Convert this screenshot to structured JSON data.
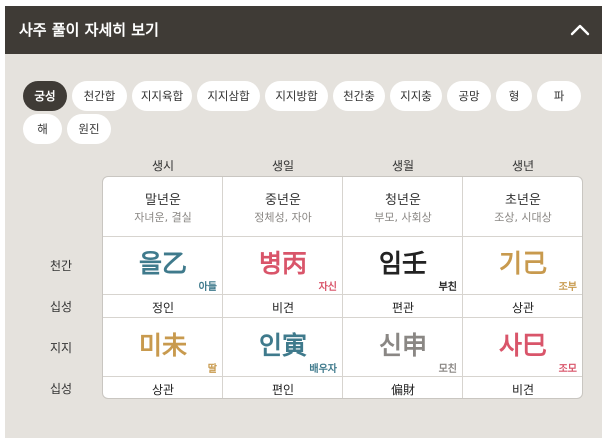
{
  "header": {
    "title": "사주 풀이 자세히 보기",
    "toggle_icon": "chevron-up-icon"
  },
  "tabs": [
    {
      "label": "궁성",
      "active": true
    },
    {
      "label": "천간합"
    },
    {
      "label": "지지육합"
    },
    {
      "label": "지지삼합"
    },
    {
      "label": "지지방합"
    },
    {
      "label": "천간충"
    },
    {
      "label": "지지충"
    },
    {
      "label": "공망"
    },
    {
      "label": "형"
    },
    {
      "label": "파"
    },
    {
      "label": "해"
    },
    {
      "label": "원진"
    }
  ],
  "columns": [
    "생시",
    "생일",
    "생월",
    "생년"
  ],
  "rows": {
    "cheongan": "천간",
    "sipseong_top": "십성",
    "jiji": "지지",
    "sipseong_bottom": "십성"
  },
  "life": [
    {
      "title": "말년운",
      "sub": "자녀운, 결실"
    },
    {
      "title": "중년운",
      "sub": "정체성, 자아"
    },
    {
      "title": "청년운",
      "sub": "부모, 사회상"
    },
    {
      "title": "초년운",
      "sub": "조상, 시대상"
    }
  ],
  "cheongan": [
    {
      "text": "을乙",
      "tag": "아들",
      "color": "#3f7a8c"
    },
    {
      "text": "병丙",
      "tag": "자신",
      "color": "#d9556a"
    },
    {
      "text": "임壬",
      "tag": "부친",
      "color": "#222222"
    },
    {
      "text": "기己",
      "tag": "조부",
      "color": "#c89a4e"
    }
  ],
  "sipseong_top": [
    "정인",
    "비견",
    "편관",
    "상관"
  ],
  "jiji": [
    {
      "text": "미未",
      "tag": "딸",
      "color": "#c89a4e"
    },
    {
      "text": "인寅",
      "tag": "배우자",
      "color": "#3f7a8c"
    },
    {
      "text": "신申",
      "tag": "모친",
      "color": "#8a8784"
    },
    {
      "text": "사巳",
      "tag": "조모",
      "color": "#d9556a"
    }
  ],
  "sipseong_bottom": [
    "상관",
    "편인",
    "偏財",
    "비견"
  ]
}
